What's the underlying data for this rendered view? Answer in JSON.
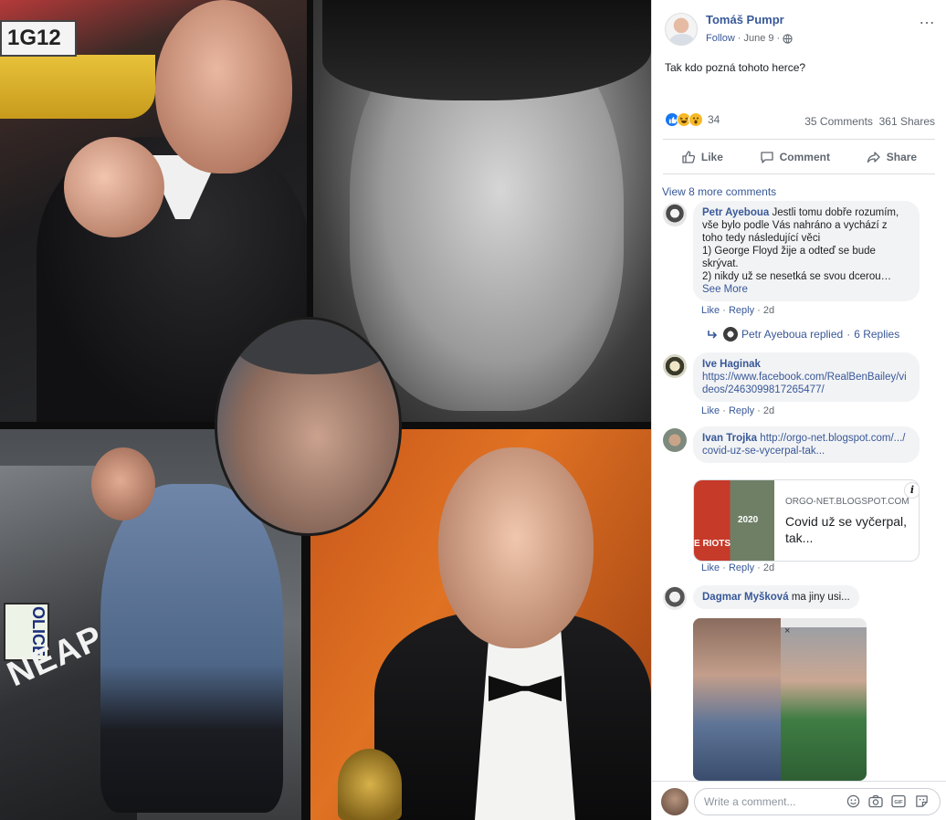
{
  "post": {
    "author": "Tomáš Pumpr",
    "follow_label": "Follow",
    "dot": "·",
    "date": "June 9",
    "more_icon": "…",
    "text": "Tak kdo pozná tohoto herce?",
    "reaction_count": "34",
    "comments_count": "35 Comments",
    "shares_count": "361 Shares"
  },
  "photo": {
    "taxi_sign": "1G12",
    "car_text": "NEAPOLIS",
    "police_text": "OLICE"
  },
  "actions": {
    "like": "Like",
    "comment": "Comment",
    "share": "Share"
  },
  "comments": {
    "view_more": "View 8 more comments",
    "items": [
      {
        "name": "Petr Ayeboua",
        "text1": "Jestli tomu dobře rozumím, vše bylo podle Vás nahráno a vychází z toho tedy následující věci",
        "text2": "1) George Floyd žije a odteď se bude skrývat.",
        "text3": "2) nikdy už se nesetká se svou dcerou…",
        "see_more": "See More",
        "like": "Like",
        "reply": "Reply",
        "time": "2d",
        "replies_author": "Petr Ayeboua replied",
        "replies_count": "6 Replies"
      },
      {
        "name": "Ive Haginak",
        "link": "https://www.facebook.com/RealBenBailey/videos/2463099817265477/",
        "like": "Like",
        "reply": "Reply",
        "time": "2d"
      },
      {
        "name": "Ivan Trojka",
        "link": "http://orgo-net.blogspot.com/.../covid-uz-se-vycerpal-tak...",
        "card_domain": "ORGO-NET.BLOGSPOT.COM",
        "card_title": "Covid už se vyčerpal, tak...",
        "card_img_text1": "E RIOTS",
        "card_img_text2": "2020",
        "card_info": "i",
        "like": "Like",
        "reply": "Reply",
        "time": "2d"
      },
      {
        "name": "Dagmar Myšková",
        "text": "ma jiny usi...",
        "photo_close": "×"
      }
    ]
  },
  "composer": {
    "placeholder": "Write a comment...",
    "gif_label": "GIF"
  }
}
